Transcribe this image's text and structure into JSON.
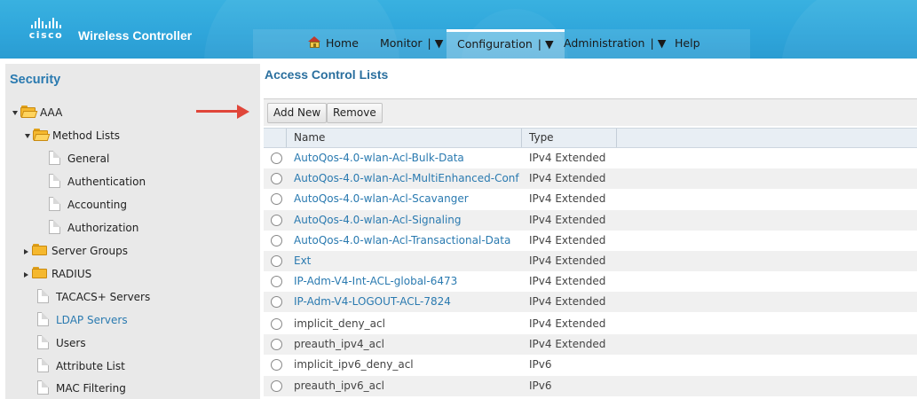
{
  "header": {
    "logo_text": "cisco",
    "product": "Wireless Controller",
    "nav": [
      {
        "label": "Home",
        "icon": "home-icon",
        "dropdown": false
      },
      {
        "label": "Monitor",
        "dropdown": true
      },
      {
        "label": "Configuration",
        "dropdown": true,
        "active": true
      },
      {
        "label": "Administration",
        "dropdown": true
      },
      {
        "label": "Help",
        "dropdown": false
      }
    ]
  },
  "sidebar": {
    "title": "Security",
    "items": [
      {
        "label": "AAA",
        "icon": "open-folder-icon",
        "expanded": true
      },
      {
        "label": "Method Lists",
        "icon": "open-folder-icon",
        "expanded": true
      },
      {
        "label": "General",
        "icon": "document-icon"
      },
      {
        "label": "Authentication",
        "icon": "document-icon"
      },
      {
        "label": "Accounting",
        "icon": "document-icon"
      },
      {
        "label": "Authorization",
        "icon": "document-icon"
      },
      {
        "label": "Server Groups",
        "icon": "folder-icon",
        "expanded": false
      },
      {
        "label": "RADIUS",
        "icon": "folder-icon",
        "expanded": false
      },
      {
        "label": "TACACS+ Servers",
        "icon": "document-icon"
      },
      {
        "label": "LDAP Servers",
        "icon": "document-icon",
        "link": true
      },
      {
        "label": "Users",
        "icon": "document-icon"
      },
      {
        "label": "Attribute List",
        "icon": "document-icon"
      },
      {
        "label": "MAC Filtering",
        "icon": "document-icon"
      }
    ]
  },
  "main": {
    "title": "Access Control Lists",
    "buttons": {
      "add_new": "Add New",
      "remove": "Remove"
    },
    "columns": {
      "name": "Name",
      "type": "Type"
    },
    "rows": [
      {
        "name": "AutoQos-4.0-wlan-Acl-Bulk-Data",
        "type": "IPv4 Extended",
        "link": true
      },
      {
        "name": "AutoQos-4.0-wlan-Acl-MultiEnhanced-Conf",
        "type": "IPv4 Extended",
        "link": true
      },
      {
        "name": "AutoQos-4.0-wlan-Acl-Scavanger",
        "type": "IPv4 Extended",
        "link": true
      },
      {
        "name": "AutoQos-4.0-wlan-Acl-Signaling",
        "type": "IPv4 Extended",
        "link": true
      },
      {
        "name": "AutoQos-4.0-wlan-Acl-Transactional-Data",
        "type": "IPv4 Extended",
        "link": true
      },
      {
        "name": "Ext",
        "type": "IPv4 Extended",
        "link": true
      },
      {
        "name": "IP-Adm-V4-Int-ACL-global-6473",
        "type": "IPv4 Extended",
        "link": true
      },
      {
        "name": "IP-Adm-V4-LOGOUT-ACL-7824",
        "type": "IPv4 Extended",
        "link": true
      },
      {
        "name": "implicit_deny_acl",
        "type": "IPv4 Extended",
        "link": false
      },
      {
        "name": "preauth_ipv4_acl",
        "type": "IPv4 Extended",
        "link": false
      },
      {
        "name": "implicit_ipv6_deny_acl",
        "type": "IPv6",
        "link": false
      },
      {
        "name": "preauth_ipv6_acl",
        "type": "IPv6",
        "link": false
      }
    ]
  },
  "colors": {
    "header": "#2fa6db",
    "link": "#2a7ab0",
    "arrow": "#e0463a"
  }
}
